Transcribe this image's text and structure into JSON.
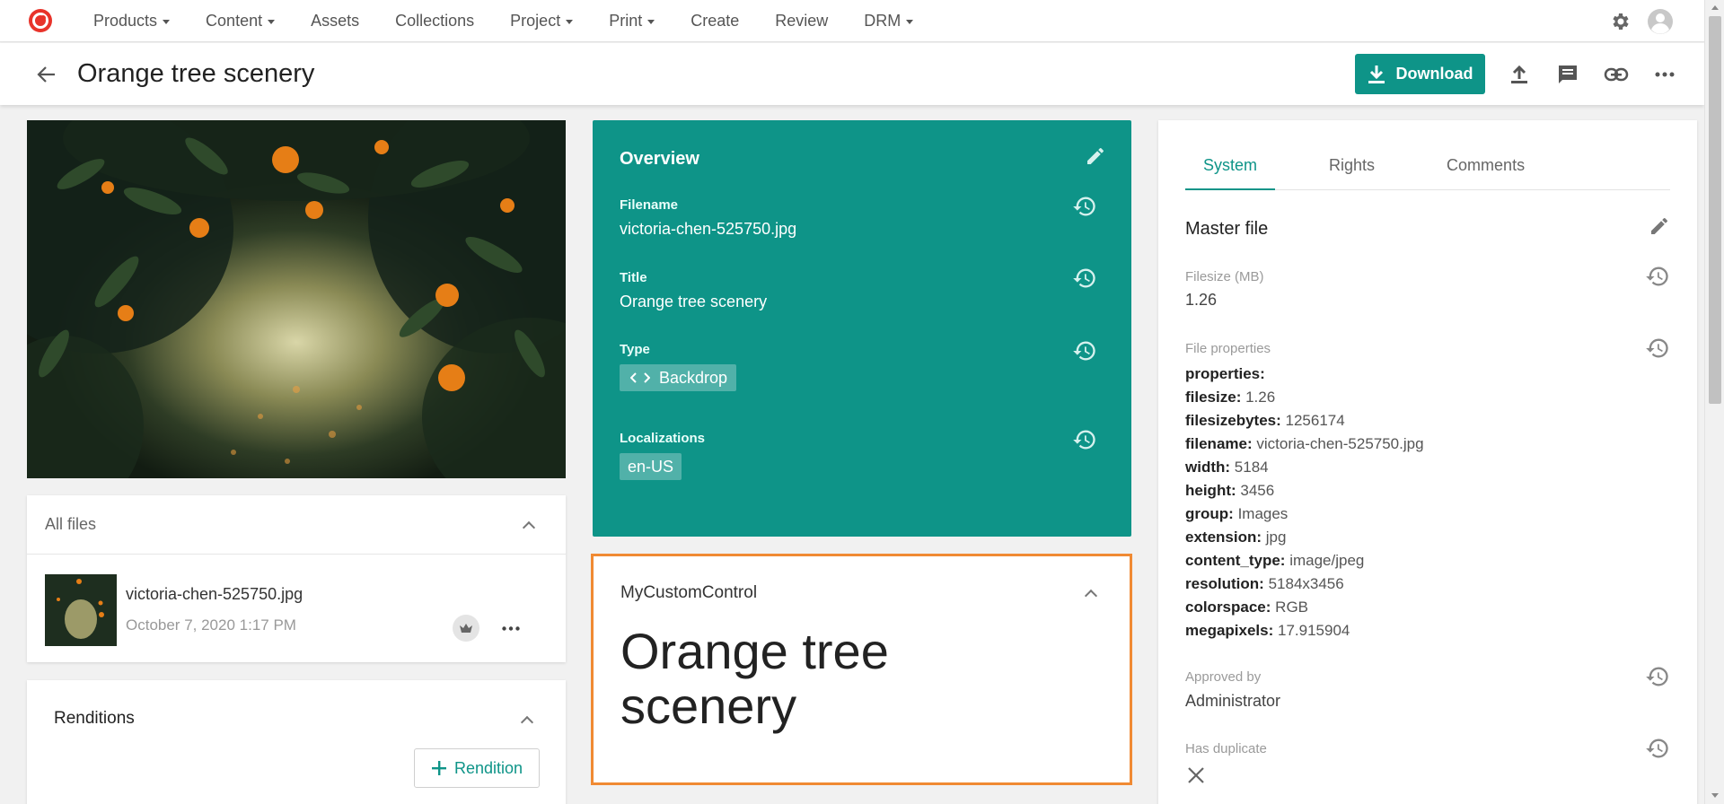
{
  "nav": {
    "items": [
      {
        "label": "Products",
        "dropdown": true
      },
      {
        "label": "Content",
        "dropdown": true
      },
      {
        "label": "Assets",
        "dropdown": false
      },
      {
        "label": "Collections",
        "dropdown": false
      },
      {
        "label": "Project",
        "dropdown": true
      },
      {
        "label": "Print",
        "dropdown": true
      },
      {
        "label": "Create",
        "dropdown": false
      },
      {
        "label": "Review",
        "dropdown": false
      },
      {
        "label": "DRM",
        "dropdown": true
      }
    ]
  },
  "header": {
    "title": "Orange tree scenery",
    "download_label": "Download"
  },
  "all_files": {
    "title": "All files",
    "file": {
      "name": "victoria-chen-525750.jpg",
      "date": "October 7, 2020 1:17 PM"
    }
  },
  "renditions": {
    "title": "Renditions",
    "button_label": "Rendition"
  },
  "overview": {
    "title": "Overview",
    "filename_label": "Filename",
    "filename": "victoria-chen-525750.jpg",
    "title_label": "Title",
    "title_value": "Orange tree scenery",
    "type_label": "Type",
    "type_value": "Backdrop",
    "localizations_label": "Localizations",
    "localization": "en-US"
  },
  "custom_control": {
    "title": "MyCustomControl",
    "big_text": "Orange tree scenery"
  },
  "system": {
    "tabs": [
      "System",
      "Rights",
      "Comments"
    ],
    "active_tab": "System",
    "master_file_title": "Master file",
    "filesize_label": "Filesize (MB)",
    "filesize": "1.26",
    "file_properties_label": "File properties",
    "properties_heading": "properties:",
    "properties": [
      {
        "key": "filesize:",
        "value": "1.26"
      },
      {
        "key": "filesizebytes:",
        "value": "1256174"
      },
      {
        "key": "filename:",
        "value": "victoria-chen-525750.jpg"
      },
      {
        "key": "width:",
        "value": "5184"
      },
      {
        "key": "height:",
        "value": "3456"
      },
      {
        "key": "group:",
        "value": "Images"
      },
      {
        "key": "extension:",
        "value": "jpg"
      },
      {
        "key": "content_type:",
        "value": "image/jpeg"
      },
      {
        "key": "resolution:",
        "value": "5184x3456"
      },
      {
        "key": "colorspace:",
        "value": "RGB"
      },
      {
        "key": "megapixels:",
        "value": "17.915904"
      }
    ],
    "approved_by_label": "Approved by",
    "approved_by": "Administrator",
    "has_duplicate_label": "Has duplicate"
  },
  "colors": {
    "accent": "#0e9488",
    "highlight_border": "#f08a33",
    "logo": "#e8332a"
  },
  "icons": [
    "logo-icon",
    "settings-icon",
    "user-avatar-icon",
    "back-arrow-icon",
    "download-icon",
    "upload-icon",
    "comment-icon",
    "link-icon",
    "more-icon",
    "edit-icon",
    "history-icon",
    "crown-icon",
    "plus-icon",
    "chevron-up-icon",
    "code-icon",
    "close-icon"
  ]
}
